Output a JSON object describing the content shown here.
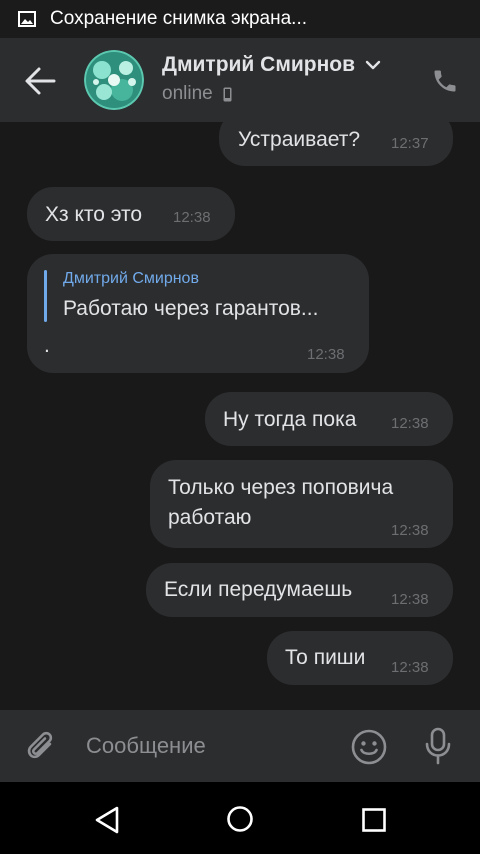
{
  "status_bar": {
    "notification_icon": "image-icon",
    "notification_text": "Сохранение снимка экрана..."
  },
  "header": {
    "back_icon": "arrow-left-icon",
    "contact_name": "Дмитрий Смирнов",
    "dropdown_icon": "chevron-down-icon",
    "presence": "online",
    "presence_icon": "mobile-device-icon",
    "call_icon": "phone-icon"
  },
  "messages": [
    {
      "direction": "out",
      "text": "Устраивает?",
      "time": "12:37"
    },
    {
      "direction": "in",
      "text": "Хз кто это",
      "time": "12:38"
    },
    {
      "direction": "in",
      "reply_author": "Дмитрий Смирнов",
      "reply_text": "Работаю через гарантов...",
      "text": ".",
      "time": "12:38"
    },
    {
      "direction": "out",
      "text": "Ну тогда пока",
      "time": "12:38"
    },
    {
      "direction": "out",
      "text_lines": [
        "Только через поповича",
        "работаю"
      ],
      "time": "12:38"
    },
    {
      "direction": "out",
      "text": "Если передумаешь",
      "time": "12:38"
    },
    {
      "direction": "out",
      "text": "То пиши",
      "time": "12:38"
    }
  ],
  "composer": {
    "attach_icon": "paperclip-icon",
    "placeholder": "Сообщение",
    "value": "",
    "emoji_icon": "smiley-icon",
    "mic_icon": "microphone-icon"
  },
  "nav_bar": {
    "back_icon": "triangle-back-icon",
    "home_icon": "circle-home-icon",
    "recents_icon": "square-recents-icon"
  },
  "colors": {
    "background": "#19191a",
    "bubble": "#2c2d2e",
    "header": "#2c2d2e",
    "accent": "#71aaeb",
    "text": "#e1e3e6",
    "muted": "#8c8e92"
  }
}
